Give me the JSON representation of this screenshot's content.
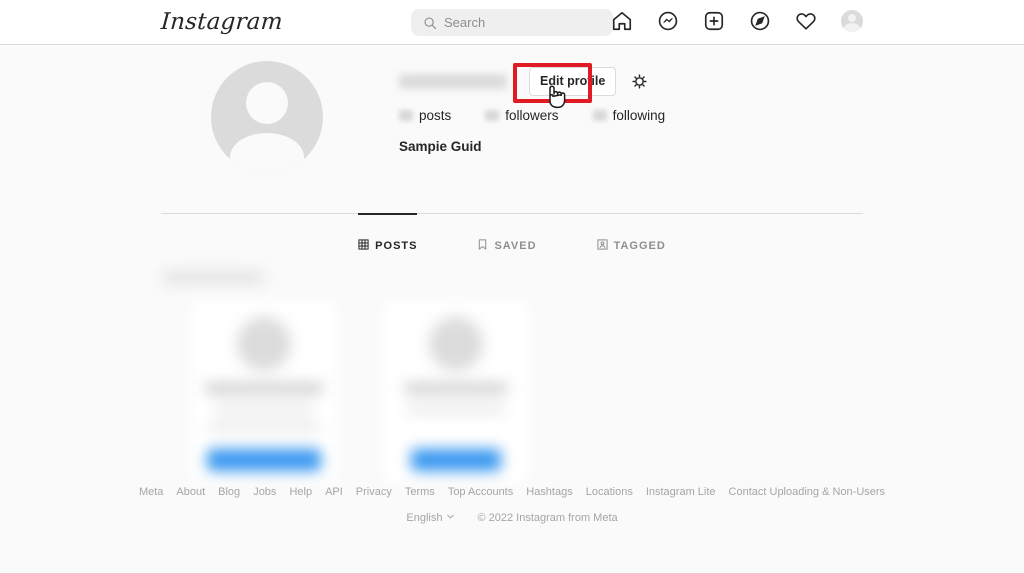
{
  "header": {
    "logo": "Instagram",
    "search": {
      "placeholder": "Search",
      "value": "",
      "icon": "search-icon"
    },
    "nav": [
      {
        "name": "home-icon",
        "label": "Home"
      },
      {
        "name": "messenger-icon",
        "label": "Messages"
      },
      {
        "name": "new-post-icon",
        "label": "New post"
      },
      {
        "name": "explore-compass-icon",
        "label": "Explore"
      },
      {
        "name": "heart-icon",
        "label": "Activity"
      },
      {
        "name": "profile-avatar",
        "label": "Profile"
      }
    ]
  },
  "profile": {
    "username": "",
    "username_blurred": true,
    "edit_profile_label": "Edit profile",
    "settings_icon": "gear-icon",
    "avatar": "default-person-avatar",
    "stats": [
      {
        "count": "",
        "label": "posts",
        "blurred": true
      },
      {
        "count": "",
        "label": "followers",
        "blurred": true
      },
      {
        "count": "",
        "label": "following",
        "blurred": true
      }
    ],
    "full_name": "Sampie Guid"
  },
  "tabs": [
    {
      "label": "POSTS",
      "icon": "grid-icon",
      "active": true
    },
    {
      "label": "SAVED",
      "icon": "bookmark-icon",
      "active": false
    },
    {
      "label": "TAGGED",
      "icon": "tagged-person-icon",
      "active": false
    }
  ],
  "body": {
    "blurred": true,
    "description": "blurred suggestion cards area"
  },
  "footer": {
    "links": [
      "Meta",
      "About",
      "Blog",
      "Jobs",
      "Help",
      "API",
      "Privacy",
      "Terms",
      "Top Accounts",
      "Hashtags",
      "Locations",
      "Instagram Lite",
      "Contact Uploading & Non-Users"
    ],
    "language": "English",
    "copyright": "© 2022 Instagram from Meta"
  },
  "annotation": {
    "target": "Edit profile",
    "box_color": "#e01b24",
    "cursor": "pointing-hand-cursor"
  }
}
